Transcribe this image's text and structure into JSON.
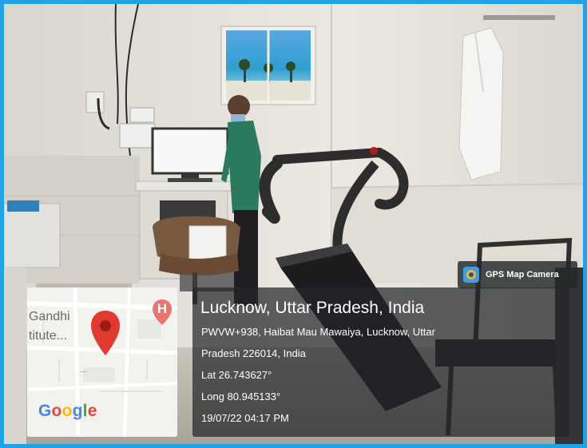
{
  "badge": {
    "icon": "camera-pin-icon",
    "label": "GPS Map Camera"
  },
  "location": {
    "title": "Lucknow, Uttar Pradesh, India",
    "address_line1": "PWVW+938, Haibat Mau Mawaiya, Lucknow, Uttar",
    "address_line2": "Pradesh 226014, India",
    "lat": "Lat 26.743627°",
    "long": "Long 80.945133°",
    "datetime": "19/07/22 04:17 PM"
  },
  "map": {
    "label_top": "Gandhi",
    "label_bottom": "titute...",
    "ellipsis": "...",
    "poi_letter": "H",
    "pin_icon": "map-pin-icon",
    "logo": "Google",
    "colors": {
      "pin": "#e03a2f",
      "poi": "#e8766d",
      "google_blue": "#4285f4",
      "google_red": "#ea4335",
      "google_yellow": "#fbbc05",
      "google_green": "#34a853"
    }
  },
  "frame_color": "#1ea3e4"
}
